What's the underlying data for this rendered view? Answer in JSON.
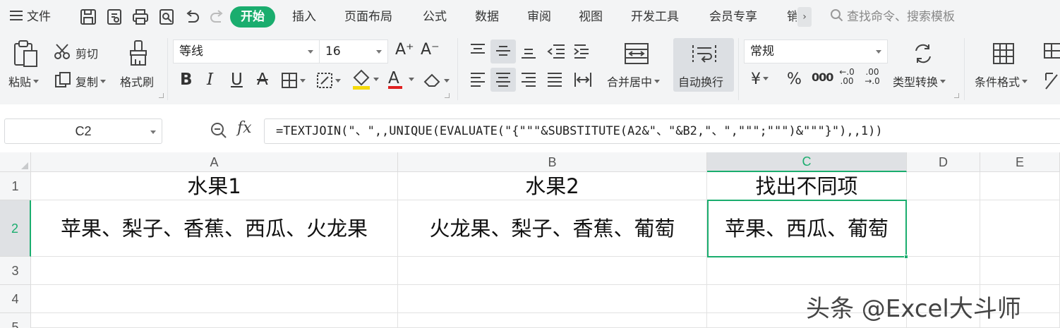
{
  "menu": {
    "file_label": "文件",
    "tabs": [
      "开始",
      "插入",
      "页面布局",
      "公式",
      "数据",
      "审阅",
      "视图",
      "开发工具",
      "会员专享",
      "销"
    ],
    "active_tab": "开始",
    "more_symbol": "›",
    "search_placeholder": "查找命令、搜索模板"
  },
  "ribbon": {
    "paste_label": "粘贴",
    "cut_label": "剪切",
    "copy_label": "复制",
    "format_painter_label": "格式刷",
    "font_name": "等线",
    "font_size": "16",
    "increase_font": "A⁺",
    "decrease_font": "A⁻",
    "bold": "B",
    "italic": "I",
    "underline": "U",
    "strikethrough": "A",
    "font_color": "A",
    "merge_center_label": "合并居中",
    "wrap_text_label": "自动换行",
    "number_format": "常规",
    "currency_symbol": "¥",
    "percent_symbol": "%",
    "thousands_symbol": "000",
    "increase_decimal": "←.0 .00",
    "decrease_decimal": ".00 →.0",
    "type_convert_label": "类型转换",
    "cond_format_label": "条件格式",
    "accent_color": "#1aad6e",
    "fill_color": "#f5d90a",
    "font_color_bar": "#e02020"
  },
  "formula_bar": {
    "name_box": "C2",
    "fx_label": "fx",
    "formula": "=TEXTJOIN(\"、\",,UNIQUE(EVALUATE(\"{\"\"\"&SUBSTITUTE(A2&\"、\"&B2,\"、\",\"\"\";\"\"\")&\"\"\"}\"),,1))"
  },
  "sheet": {
    "columns": [
      "A",
      "B",
      "C",
      "D",
      "E"
    ],
    "rows": [
      "1",
      "2",
      "3",
      "4",
      "5"
    ],
    "active_cell": "C2",
    "cells": {
      "A1": "水果1",
      "B1": "水果2",
      "C1": "找出不同项",
      "A2": "苹果、梨子、香蕉、西瓜、火龙果",
      "B2": "火龙果、梨子、香蕉、葡萄",
      "C2": "苹果、西瓜、葡萄"
    }
  },
  "watermark": "头条 @Excel大斗师"
}
